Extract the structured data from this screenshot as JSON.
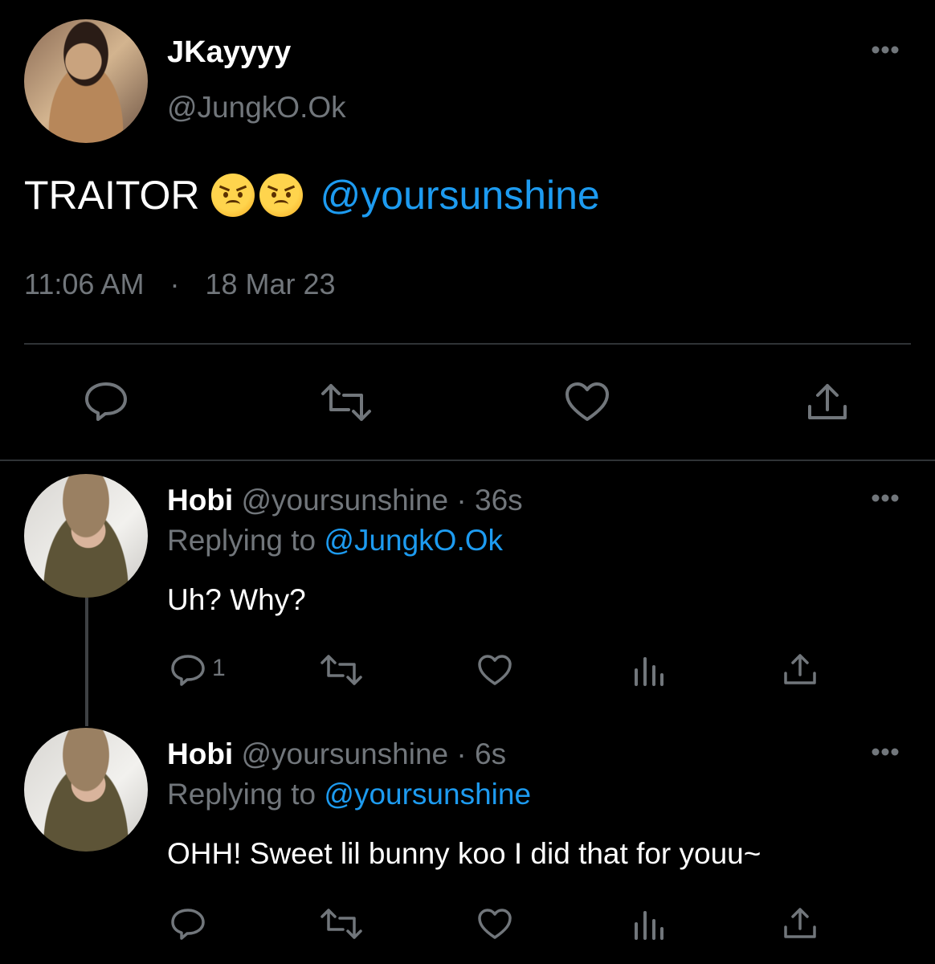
{
  "main_tweet": {
    "display_name": "JKayyyy",
    "handle": "@JungkO.Ok",
    "text": "TRAITOR",
    "emojis": [
      "angry-face",
      "angry-face"
    ],
    "mention": "@yoursunshine",
    "time": "11:06 AM",
    "separator": "·",
    "date": "18 Mar 23"
  },
  "replies": [
    {
      "display_name": "Hobi",
      "handle": "@yoursunshine",
      "dot": "·",
      "age": "36s",
      "replying_label": "Replying to",
      "replying_to": "@JungkO.Ok",
      "text": "Uh? Why?",
      "reply_count": "1"
    },
    {
      "display_name": "Hobi",
      "handle": "@yoursunshine",
      "dot": "·",
      "age": "6s",
      "replying_label": "Replying to",
      "replying_to": "@yoursunshine",
      "text": "OHH! Sweet lil bunny koo I did that for youu~",
      "reply_count": ""
    }
  ],
  "colors": {
    "background": "#000000",
    "text": "#e7e9ea",
    "muted": "#71767b",
    "link": "#1d9bf0",
    "divider": "#2f3336"
  }
}
